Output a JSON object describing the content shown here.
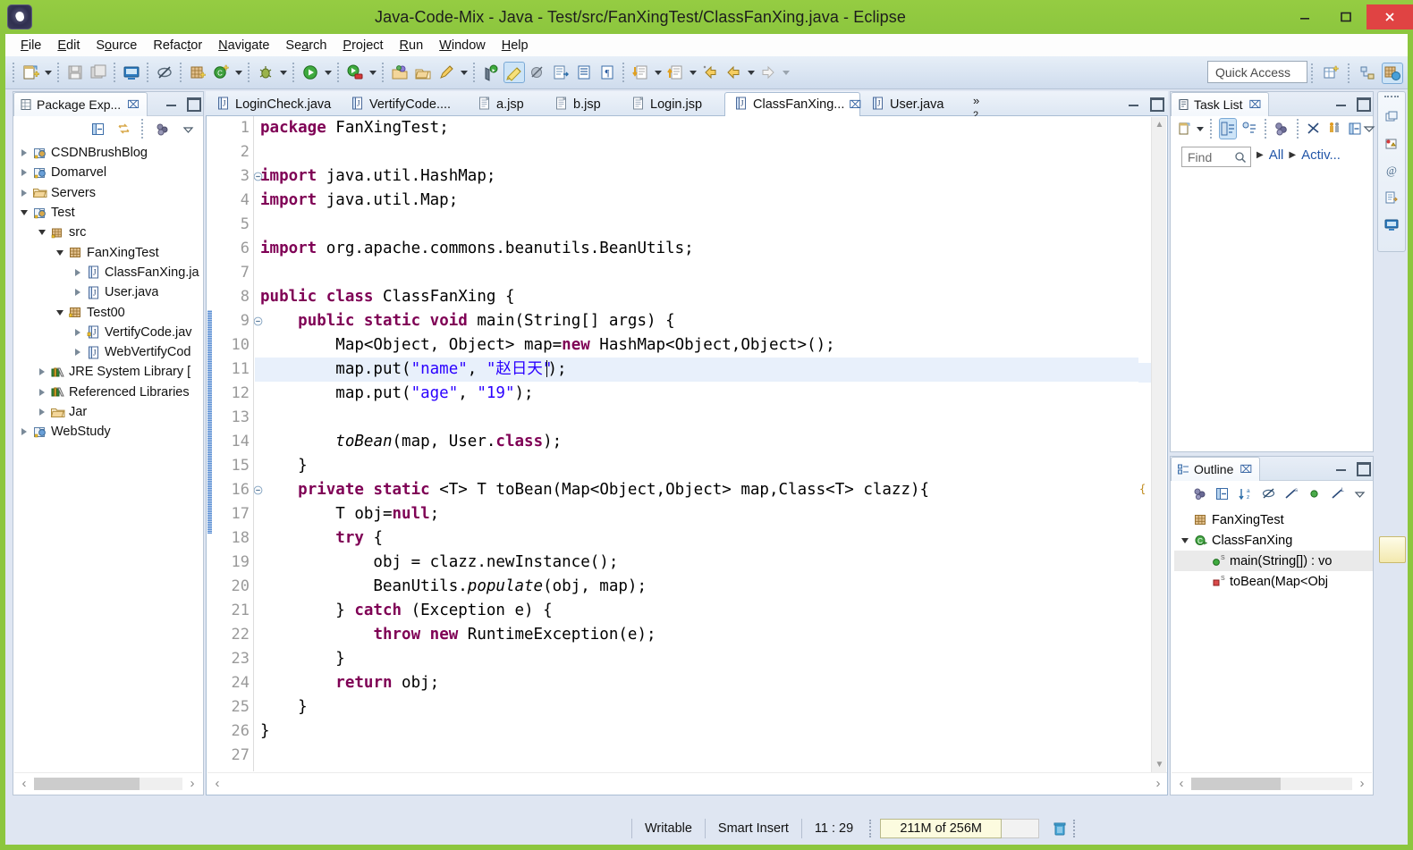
{
  "window": {
    "title": "Java-Code-Mix - Java - Test/src/FanXingTest/ClassFanXing.java - Eclipse",
    "minimize_label": "–",
    "maximize_label": "❐",
    "close_label": "✕",
    "accent_green": "#8cc63e"
  },
  "menubar": {
    "items": [
      {
        "label": "File",
        "mnemonic": "F"
      },
      {
        "label": "Edit",
        "mnemonic": "E"
      },
      {
        "label": "Source",
        "mnemonic": "o"
      },
      {
        "label": "Refactor",
        "mnemonic": "t"
      },
      {
        "label": "Navigate",
        "mnemonic": "N"
      },
      {
        "label": "Search",
        "mnemonic": "a"
      },
      {
        "label": "Project",
        "mnemonic": "P"
      },
      {
        "label": "Run",
        "mnemonic": "R"
      },
      {
        "label": "Window",
        "mnemonic": "W"
      },
      {
        "label": "Help",
        "mnemonic": "H"
      }
    ]
  },
  "toolbar": {
    "quick_access_placeholder": "Quick Access",
    "buttons": [
      "new-wizard-icon",
      "new-wizard-dropdown",
      "save-icon",
      "save-all-icon",
      "print-icon",
      "toggle-mark-occurrences-icon",
      "new-java-package-icon",
      "new-java-class-icon",
      "new-java-class-dropdown",
      "debug-icon",
      "debug-dropdown",
      "run-icon",
      "run-dropdown",
      "external-tools-icon",
      "external-tools-dropdown",
      "open-type-icon",
      "open-task-icon",
      "search-icon",
      "search-dropdown",
      "coverage-icon",
      "pencil-highlight-icon",
      "skip-breakpoints-icon",
      "next-annotation-icon",
      "previous-annotation-icon",
      "paragraph-icon",
      "next-edit-icon",
      "next-edit-dropdown",
      "previous-edit-icon",
      "previous-edit-dropdown",
      "back-icon",
      "forward-icon",
      "forward-dropdown",
      "next-arrow-icon",
      "next-arrow-dropdown"
    ],
    "perspective_buttons": [
      "open-perspective-icon",
      "java-ee-perspective-icon",
      "java-perspective-icon"
    ]
  },
  "package_explorer": {
    "title": "Package Exp...",
    "close_label": "⌧",
    "toolbar_icons": [
      "collapse-all-icon",
      "link-with-editor-icon",
      "view-menu-icon",
      "view-menu-chevron-icon"
    ],
    "tree": [
      {
        "label": "CSDNBrushBlog",
        "depth": 0,
        "state": "closed",
        "icon": "java-project-icon"
      },
      {
        "label": "Domarvel",
        "depth": 0,
        "state": "closed",
        "icon": "web-project-icon"
      },
      {
        "label": "Servers",
        "depth": 0,
        "state": "closed",
        "icon": "folder-icon"
      },
      {
        "label": "Test",
        "depth": 0,
        "state": "open",
        "icon": "java-project-icon"
      },
      {
        "label": "src",
        "depth": 1,
        "state": "open",
        "icon": "source-folder-icon"
      },
      {
        "label": "FanXingTest",
        "depth": 2,
        "state": "open",
        "icon": "package-icon"
      },
      {
        "label": "ClassFanXing.ja",
        "depth": 3,
        "state": "closed",
        "icon": "java-file-icon"
      },
      {
        "label": "User.java",
        "depth": 3,
        "state": "closed",
        "icon": "java-file-icon"
      },
      {
        "label": "Test00",
        "depth": 2,
        "state": "open",
        "icon": "package-warn-icon"
      },
      {
        "label": "VertifyCode.jav",
        "depth": 3,
        "state": "closed",
        "icon": "java-file-warn-icon"
      },
      {
        "label": "WebVertifyCod",
        "depth": 3,
        "state": "closed",
        "icon": "java-file-icon"
      },
      {
        "label": "JRE System Library [",
        "depth": 1,
        "state": "closed",
        "icon": "library-icon"
      },
      {
        "label": "Referenced Libraries",
        "depth": 1,
        "state": "closed",
        "icon": "library-icon"
      },
      {
        "label": "Jar",
        "depth": 1,
        "state": "closed",
        "icon": "folder-icon"
      },
      {
        "label": "WebStudy",
        "depth": 0,
        "state": "closed",
        "icon": "web-project-icon"
      }
    ],
    "hscroll": {
      "left_arrow": "‹",
      "right_arrow": "›"
    }
  },
  "editor": {
    "tabs": [
      {
        "label": "LoginCheck.java",
        "icon": "java-file-icon",
        "active": false
      },
      {
        "label": "VertifyCode....",
        "icon": "java-file-icon",
        "active": false
      },
      {
        "label": "a.jsp",
        "icon": "jsp-file-icon",
        "active": false
      },
      {
        "label": "b.jsp",
        "icon": "jsp-file-icon",
        "active": false
      },
      {
        "label": "Login.jsp",
        "icon": "jsp-file-icon",
        "active": false
      },
      {
        "label": "ClassFanXing...",
        "icon": "java-file-icon",
        "active": true
      },
      {
        "label": "User.java",
        "icon": "java-file-icon",
        "active": false
      }
    ],
    "overflow_label": "»",
    "overflow_count": "2",
    "close_label": "⌧",
    "highlighted_line": 11,
    "cursor_position": "11 : 29",
    "lines": [
      {
        "n": 1,
        "fold": "none",
        "tokens": [
          {
            "t": "package",
            "c": "kw"
          },
          {
            "t": " FanXingTest;",
            "c": "plain"
          }
        ]
      },
      {
        "n": 2,
        "fold": "none",
        "tokens": []
      },
      {
        "n": 3,
        "fold": "collapse",
        "tokens": [
          {
            "t": "import",
            "c": "kw"
          },
          {
            "t": " java.util.HashMap;",
            "c": "plain"
          }
        ]
      },
      {
        "n": 4,
        "fold": "none",
        "tokens": [
          {
            "t": "import",
            "c": "kw"
          },
          {
            "t": " java.util.Map;",
            "c": "plain"
          }
        ]
      },
      {
        "n": 5,
        "fold": "none",
        "tokens": []
      },
      {
        "n": 6,
        "fold": "none",
        "tokens": [
          {
            "t": "import",
            "c": "kw"
          },
          {
            "t": " org.apache.commons.beanutils.BeanUtils;",
            "c": "plain"
          }
        ]
      },
      {
        "n": 7,
        "fold": "none",
        "tokens": []
      },
      {
        "n": 8,
        "fold": "none",
        "tokens": [
          {
            "t": "public class",
            "c": "kw"
          },
          {
            "t": " ClassFanXing {",
            "c": "plain"
          }
        ]
      },
      {
        "n": 9,
        "fold": "collapse",
        "tokens": [
          {
            "t": "    ",
            "c": "plain"
          },
          {
            "t": "public static void",
            "c": "kw"
          },
          {
            "t": " main(String[] args) {",
            "c": "plain"
          }
        ]
      },
      {
        "n": 10,
        "fold": "none",
        "tokens": [
          {
            "t": "        Map<Object, Object> map=",
            "c": "plain"
          },
          {
            "t": "new",
            "c": "kw"
          },
          {
            "t": " HashMap<Object,Object>();",
            "c": "plain"
          }
        ]
      },
      {
        "n": 11,
        "fold": "none",
        "tokens": [
          {
            "t": "        map.put(",
            "c": "plain"
          },
          {
            "t": "\"name\"",
            "c": "str"
          },
          {
            "t": ", ",
            "c": "plain"
          },
          {
            "t": "\"赵日天\"",
            "c": "str"
          },
          {
            "t": ");",
            "c": "plain"
          }
        ]
      },
      {
        "n": 12,
        "fold": "none",
        "tokens": [
          {
            "t": "        map.put(",
            "c": "plain"
          },
          {
            "t": "\"age\"",
            "c": "str"
          },
          {
            "t": ", ",
            "c": "plain"
          },
          {
            "t": "\"19\"",
            "c": "str"
          },
          {
            "t": ");",
            "c": "plain"
          }
        ]
      },
      {
        "n": 13,
        "fold": "none",
        "tokens": []
      },
      {
        "n": 14,
        "fold": "none",
        "tokens": [
          {
            "t": "        ",
            "c": "plain"
          },
          {
            "t": "toBean",
            "c": "ita"
          },
          {
            "t": "(map, User.",
            "c": "plain"
          },
          {
            "t": "class",
            "c": "kw"
          },
          {
            "t": ");",
            "c": "plain"
          }
        ]
      },
      {
        "n": 15,
        "fold": "none",
        "tokens": [
          {
            "t": "    }",
            "c": "plain"
          }
        ]
      },
      {
        "n": 16,
        "fold": "collapse",
        "tokens": [
          {
            "t": "    ",
            "c": "plain"
          },
          {
            "t": "private static",
            "c": "kw"
          },
          {
            "t": " <T> T toBean(Map<Object,Object> map,Class<T> clazz){",
            "c": "plain"
          }
        ]
      },
      {
        "n": 17,
        "fold": "none",
        "tokens": [
          {
            "t": "        T obj=",
            "c": "plain"
          },
          {
            "t": "null",
            "c": "kw"
          },
          {
            "t": ";",
            "c": "plain"
          }
        ]
      },
      {
        "n": 18,
        "fold": "none",
        "tokens": [
          {
            "t": "        ",
            "c": "plain"
          },
          {
            "t": "try",
            "c": "kw"
          },
          {
            "t": " {",
            "c": "plain"
          }
        ]
      },
      {
        "n": 19,
        "fold": "none",
        "tokens": [
          {
            "t": "            obj = clazz.newInstance();",
            "c": "plain"
          }
        ]
      },
      {
        "n": 20,
        "fold": "none",
        "tokens": [
          {
            "t": "            BeanUtils.",
            "c": "plain"
          },
          {
            "t": "populate",
            "c": "ita"
          },
          {
            "t": "(obj, map);",
            "c": "plain"
          }
        ]
      },
      {
        "n": 21,
        "fold": "none",
        "tokens": [
          {
            "t": "        } ",
            "c": "plain"
          },
          {
            "t": "catch",
            "c": "kw"
          },
          {
            "t": " (Exception e) {",
            "c": "plain"
          }
        ]
      },
      {
        "n": 22,
        "fold": "none",
        "tokens": [
          {
            "t": "            ",
            "c": "plain"
          },
          {
            "t": "throw new",
            "c": "kw"
          },
          {
            "t": " RuntimeException(e);",
            "c": "plain"
          }
        ]
      },
      {
        "n": 23,
        "fold": "none",
        "tokens": [
          {
            "t": "        }",
            "c": "plain"
          }
        ]
      },
      {
        "n": 24,
        "fold": "none",
        "tokens": [
          {
            "t": "        ",
            "c": "plain"
          },
          {
            "t": "return",
            "c": "kw"
          },
          {
            "t": " obj;",
            "c": "plain"
          }
        ]
      },
      {
        "n": 25,
        "fold": "none",
        "tokens": [
          {
            "t": "    }",
            "c": "plain"
          }
        ]
      },
      {
        "n": 26,
        "fold": "none",
        "tokens": [
          {
            "t": "}",
            "c": "plain"
          }
        ]
      },
      {
        "n": 27,
        "fold": "none",
        "tokens": []
      }
    ]
  },
  "task_list": {
    "title": "Task List",
    "close_label": "⌧",
    "toolbar_icons": [
      "new-task-icon",
      "new-task-dropdown",
      "categorized-icon",
      "scheduled-icon",
      "synchronize-icon",
      "focus-on-workweek-icon",
      "show-all-icon",
      "collapse-all-icon",
      "view-menu-chevron-icon"
    ],
    "find_placeholder": "Find",
    "find_value": "",
    "search_icon": "search-icon",
    "filters": [
      "All",
      "Activ..."
    ]
  },
  "outline": {
    "title": "Outline",
    "close_label": "⌧",
    "toolbar_icons": [
      "focus-icon",
      "collapse-all-icon",
      "sort-icon",
      "hide-fields-icon",
      "hide-static-icon",
      "hide-nonpublic-icon",
      "hide-local-icon",
      "view-menu-chevron-icon"
    ],
    "items": [
      {
        "label": "FanXingTest",
        "depth": 0,
        "icon": "package-icon",
        "twist": "none",
        "selected": false
      },
      {
        "label": "ClassFanXing",
        "depth": 0,
        "icon": "class-icon",
        "twist": "open",
        "selected": false
      },
      {
        "label": "main(String[]) : vo",
        "depth": 1,
        "icon": "public-static-method-icon",
        "twist": "none",
        "selected": true
      },
      {
        "label": "toBean(Map<Obj",
        "depth": 1,
        "icon": "private-static-method-icon",
        "twist": "none",
        "selected": false
      }
    ],
    "hscroll": {
      "left_arrow": "‹",
      "right_arrow": "›"
    }
  },
  "status_bar": {
    "writable": "Writable",
    "insert_mode": "Smart Insert",
    "position": "11 : 29",
    "heap": "211M of 256M",
    "trash_icon": "trash-icon"
  }
}
